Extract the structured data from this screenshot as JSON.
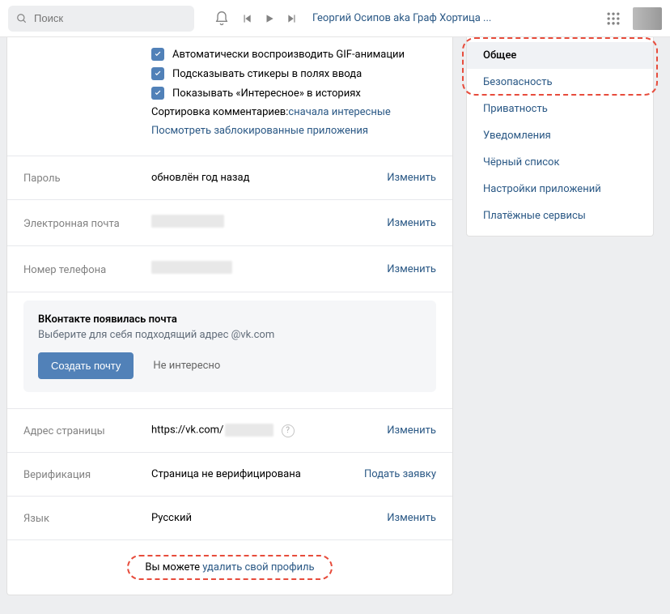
{
  "search_placeholder": "Поиск",
  "nowplaying": "Георгий Осипов aka Граф Хортица ...",
  "checkboxes": {
    "gif": "Автоматически воспроизводить GIF-анимации",
    "stickers": "Подсказывать стикеры в полях ввода",
    "stories": "Показывать «Интересное» в историях"
  },
  "sort_label": "Сортировка комментариев: ",
  "sort_value": "сначала интересные",
  "blocked_apps": "Посмотреть заблокированные приложения",
  "rows": {
    "password_label": "Пароль",
    "password_value": "обновлён год назад",
    "email_label": "Электронная почта",
    "phone_label": "Номер телефона",
    "address_label": "Адрес страницы",
    "address_value": "https://vk.com/",
    "verify_label": "Верификация",
    "verify_value": "Страница не верифицирована",
    "verify_action": "Подать заявку",
    "lang_label": "Язык",
    "lang_value": "Русский",
    "change": "Изменить"
  },
  "mail": {
    "title": "ВКонтакте появилась почта",
    "sub": "Выберите для себя подходящий адрес @vk.com",
    "create": "Создать почту",
    "dismiss": "Не интересно"
  },
  "footer_prefix": "Вы можете ",
  "footer_link": "удалить свой профиль",
  "sidebar": {
    "items": [
      "Общее",
      "Безопасность",
      "Приватность",
      "Уведомления",
      "Чёрный список",
      "Настройки приложений",
      "Платёжные сервисы"
    ]
  }
}
